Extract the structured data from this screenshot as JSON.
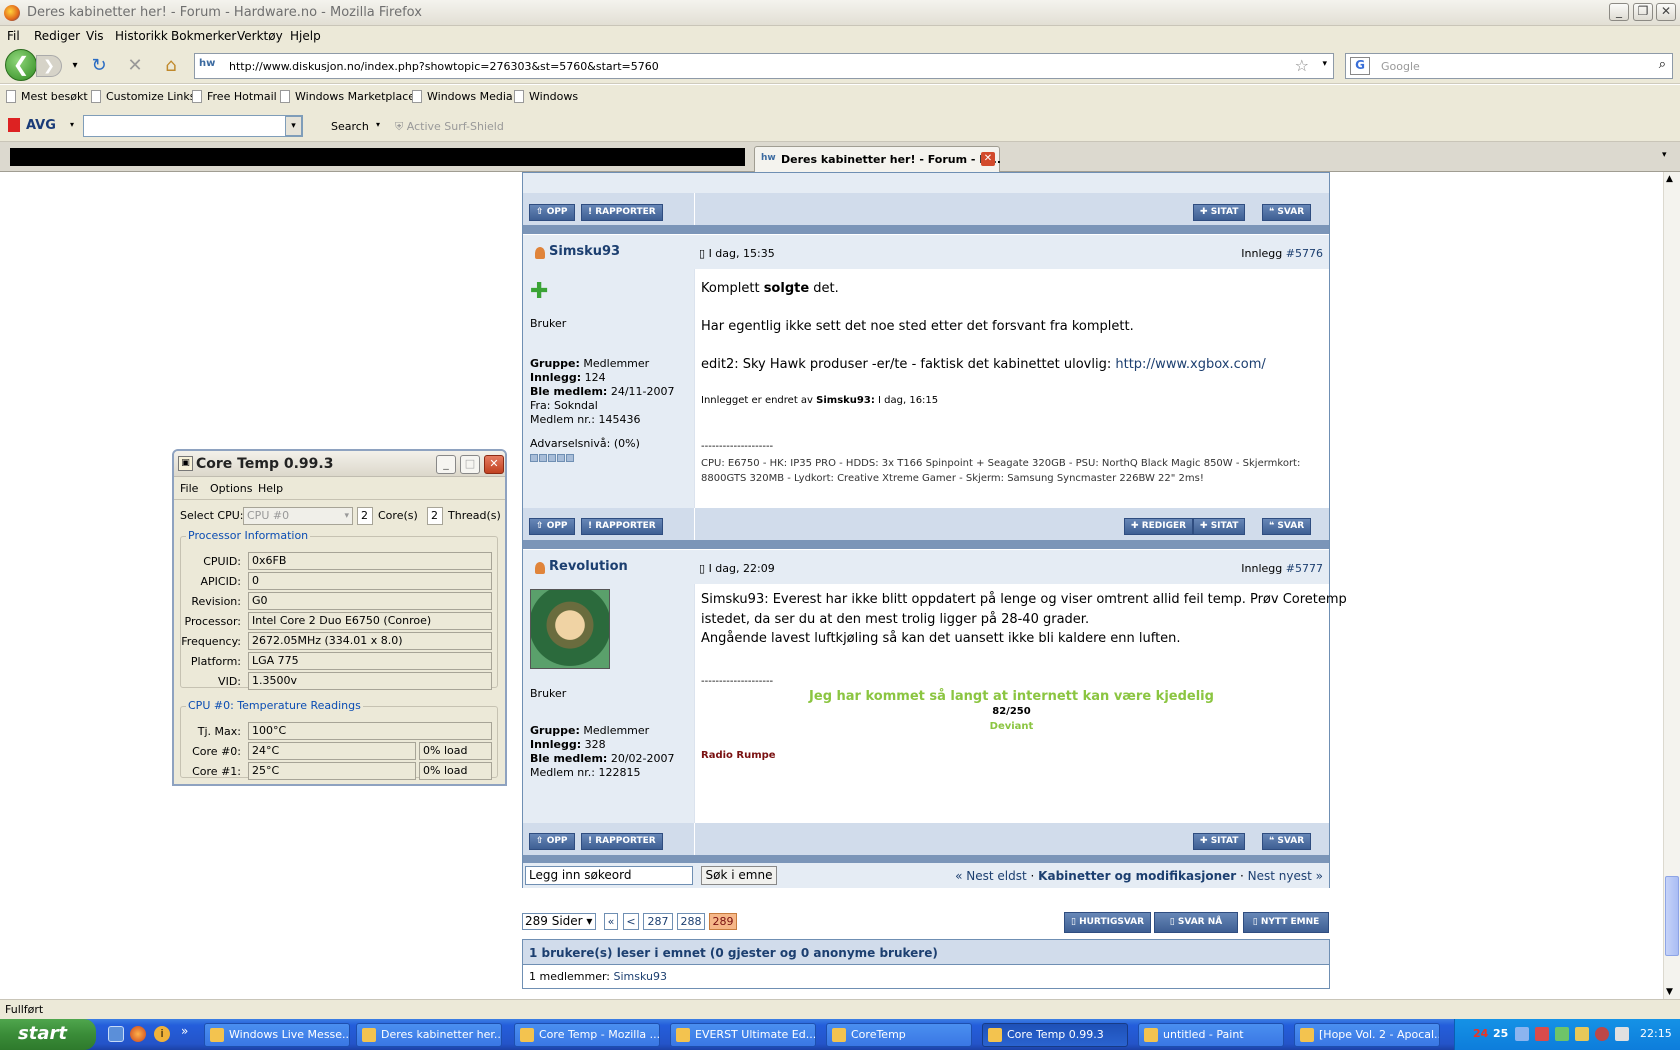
{
  "window": {
    "title": "Deres kabinetter her! - Forum - Hardware.no - Mozilla Firefox"
  },
  "menu": [
    "Fil",
    "Rediger",
    "Vis",
    "Historikk",
    "Bokmerker",
    "Verktøy",
    "Hjelp"
  ],
  "nav": {
    "url": "http://www.diskusjon.no/index.php?showtopic=276303&st=5760&start=5760",
    "url_badge": "hw",
    "search_placeholder": "Google"
  },
  "bookmarks": [
    "Mest besøkt",
    "Customize Links",
    "Free Hotmail",
    "Windows Marketplace",
    "Windows Media",
    "Windows"
  ],
  "avg": {
    "logo": "AVG",
    "search": "Search",
    "surf_shield": "Active Surf-Shield"
  },
  "tabs": {
    "active": "Deres kabinetter her! - Forum - H..."
  },
  "buttons": {
    "opp": "OPP",
    "rapporter": "RAPPORTER",
    "sitat": "SITAT",
    "svar": "SVAR",
    "rediger": "REDIGER"
  },
  "post1": {
    "user": "Simsku93",
    "date": "I dag, 15:35",
    "post_label": "Innlegg",
    "post_no": "#5776",
    "rank": "Bruker",
    "gruppe_lbl": "Gruppe:",
    "gruppe": "Medlemmer",
    "innlegg_lbl": "Innlegg:",
    "innlegg": "124",
    "medlem_lbl": "Ble medlem:",
    "medlem": "24/11-2007",
    "fra": "Fra: Sokndal",
    "medlemnr": "Medlem nr.: 145436",
    "advarsel": "Advarselsnivå: (0%)",
    "line1_a": "Komplett ",
    "line1_b": "solgte",
    "line1_c": " det.",
    "line2": "Har egentlig ikke sett det noe sted etter det forsvant fra komplett.",
    "line3_a": "edit2: Sky Hawk produser -er/te - faktisk det kabinettet ulovlig: ",
    "line3_link": "http://www.xgbox.com/",
    "edited_a": "Innlegget er endret av ",
    "edited_user": "Simsku93:",
    "edited_time": " I dag, 16:15",
    "sig_dash": "--------------------",
    "sig": "CPU: E6750 - HK: IP35 PRO - HDDS: 3x T166 Spinpoint + Seagate 320GB - PSU: NorthQ Black Magic 850W - Skjermkort: 8800GTS 320MB - Lydkort: Creative Xtreme Gamer - Skjerm: Samsung Syncmaster 226BW 22\" 2ms!"
  },
  "post2": {
    "user": "Revolution",
    "date": "I dag, 22:09",
    "post_label": "Innlegg",
    "post_no": "#5777",
    "rank": "Bruker",
    "gruppe_lbl": "Gruppe:",
    "gruppe": "Medlemmer",
    "innlegg_lbl": "Innlegg:",
    "innlegg": "328",
    "medlem_lbl": "Ble medlem:",
    "medlem": "20/02-2007",
    "medlemnr": "Medlem nr.: 122815",
    "line1": "Simsku93: Everest har ikke blitt oppdatert på lenge og viser omtrent allid feil temp. Prøv Coretemp",
    "line2": "istedet, da ser du at den mest trolig ligger på 28-40 grader.",
    "line3": "Angående lavest luftkjøling så kan det uansett ikke bli kaldere enn luften.",
    "sig_dash": "--------------------",
    "sig_main": "Jeg har kommet så langt at internett kan være kjedelig",
    "sig_score": "82/250",
    "sig_deviant": "Deviant",
    "sig_radio": "Radio Rumpe"
  },
  "search_row": {
    "placeholder": "Legg inn søkeord",
    "button": "Søk i emne",
    "prev": "« Nest eldst",
    "forum": "Kabinetter og modifikasjoner",
    "next": "Nest nyest »"
  },
  "pagination": {
    "pages": "289 Sider ▾",
    "first": "«",
    "prev": "<",
    "p1": "287",
    "p2": "288",
    "current": "289"
  },
  "actions": {
    "hurtigsvar": "HURTIGSVAR",
    "svar_na": "SVAR NÅ",
    "nytt_emne": "NYTT EMNE"
  },
  "readers": {
    "title": "1 brukere(s) leser i emnet (0 gjester og 0 anonyme brukere)",
    "members_lbl": "1 medlemmer: ",
    "member": "Simsku93"
  },
  "coretemp": {
    "title": "Core Temp 0.99.3",
    "menu": [
      "File",
      "Options",
      "Help"
    ],
    "select_cpu_lbl": "Select CPU:",
    "select_cpu": "CPU #0",
    "cores": "2",
    "cores_lbl": "Core(s)",
    "threads": "2",
    "threads_lbl": "Thread(s)",
    "proc_group": "Processor Information",
    "rows": [
      {
        "label": "CPUID:",
        "value": "0x6FB"
      },
      {
        "label": "APICID:",
        "value": "0"
      },
      {
        "label": "Revision:",
        "value": "G0"
      },
      {
        "label": "Processor:",
        "value": "Intel Core 2 Duo E6750 (Conroe)"
      },
      {
        "label": "Frequency:",
        "value": "2672.05MHz (334.01 x 8.0)"
      },
      {
        "label": "Platform:",
        "value": "LGA 775"
      },
      {
        "label": "VID:",
        "value": "1.3500v"
      }
    ],
    "temp_group": "CPU #0: Temperature Readings",
    "tjmax_lbl": "Tj. Max:",
    "tjmax": "100°C",
    "core0_lbl": "Core #0:",
    "core0": "24°C",
    "core0_load": "0% load",
    "core1_lbl": "Core #1:",
    "core1": "25°C",
    "core1_load": "0% load"
  },
  "status": "Fullført",
  "taskbar": {
    "start": "start",
    "tasks": [
      "Windows Live Messe...",
      "Deres kabinetter her...",
      "Core Temp - Mozilla ...",
      "EVERST Ultimate Ed...",
      "CoreTemp",
      "Core Temp 0.99.3",
      "untitled - Paint",
      "[Hope Vol. 2 - Apocal..."
    ],
    "tray_a": "24",
    "tray_b": "25",
    "clock": "22:15"
  }
}
